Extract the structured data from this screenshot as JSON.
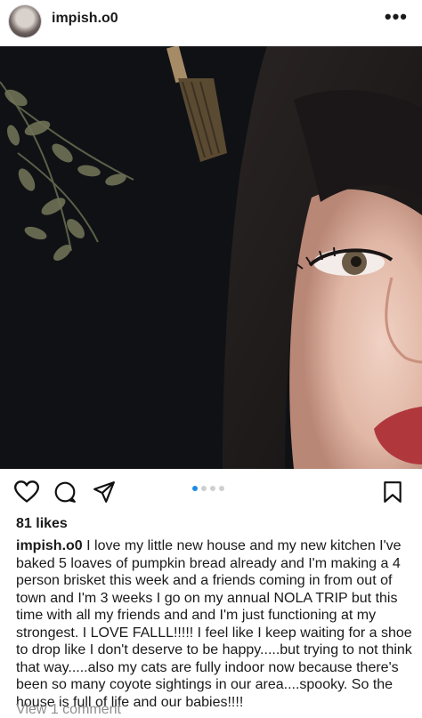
{
  "post": {
    "username": "impish.o0",
    "more_icon": "more-horizontal-icon",
    "likes": "81 likes",
    "caption_username": "impish.o0",
    "caption_text": " I love my little new house and my new kitchen I've baked 5 loaves of pumpkin bread already and I'm making a 4 person brisket this week and a friends coming in from out of town and I'm 3 weeks I go on my annual NOLA TRIP but this time with all my friends and and I'm just functioning at my strongest. I LOVE FALLL!!!!! I feel like I keep waiting for a shoe to drop like I don't deserve to be happy.....but trying to not think that way.....also my cats are fully indoor now because there's been so many coyote sightings in our area....spooky. So the house is full of life and our babies!!!!",
    "view_comments": "View 1 comment",
    "carousel": {
      "total": 4,
      "active": 1
    }
  },
  "icons": [
    "heart-icon",
    "comment-icon",
    "share-icon",
    "bookmark-icon"
  ],
  "colors": {
    "accent": "#1e8be6",
    "muted": "#8e8e8e",
    "text": "#1a1a1a"
  }
}
